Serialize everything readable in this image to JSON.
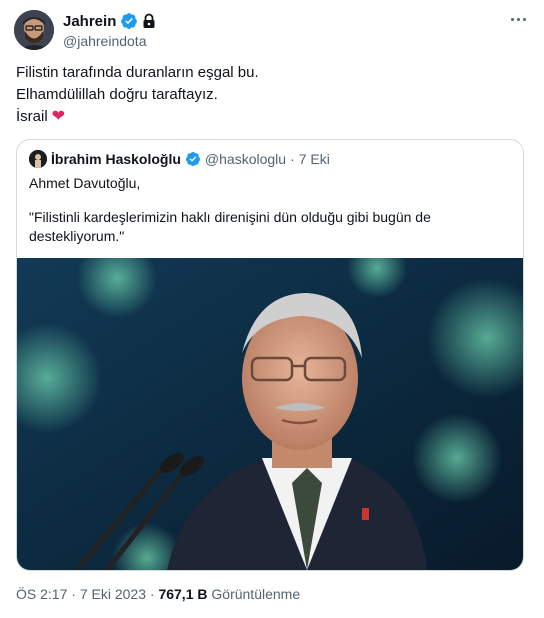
{
  "author": {
    "name": "Jahrein",
    "handle": "@jahreindota"
  },
  "tweet": {
    "lines": [
      "Filistin tarafında duranların eşgal bu.",
      "Elhamdülillah doğru taraftayız.",
      "İsrail"
    ],
    "heart_emoji": "❤"
  },
  "quoted": {
    "name": "İbrahim Haskoloğlu",
    "handle": "@haskologlu",
    "separator": "·",
    "date": "7 Eki",
    "line1": "Ahmet Davutoğlu,",
    "line2": "\"Filistinli kardeşlerimizin haklı direnişini dün olduğu gibi bugün de destekliyorum.\""
  },
  "footer": {
    "time": "ÖS 2:17",
    "sep1": "·",
    "date": "7 Eki 2023",
    "sep2": "·",
    "views_count": "767,1 B",
    "views_label": "Görüntülenme"
  },
  "colors": {
    "verified": "#1d9bf0",
    "heart": "#e0245e",
    "secondary_text": "#536471"
  }
}
